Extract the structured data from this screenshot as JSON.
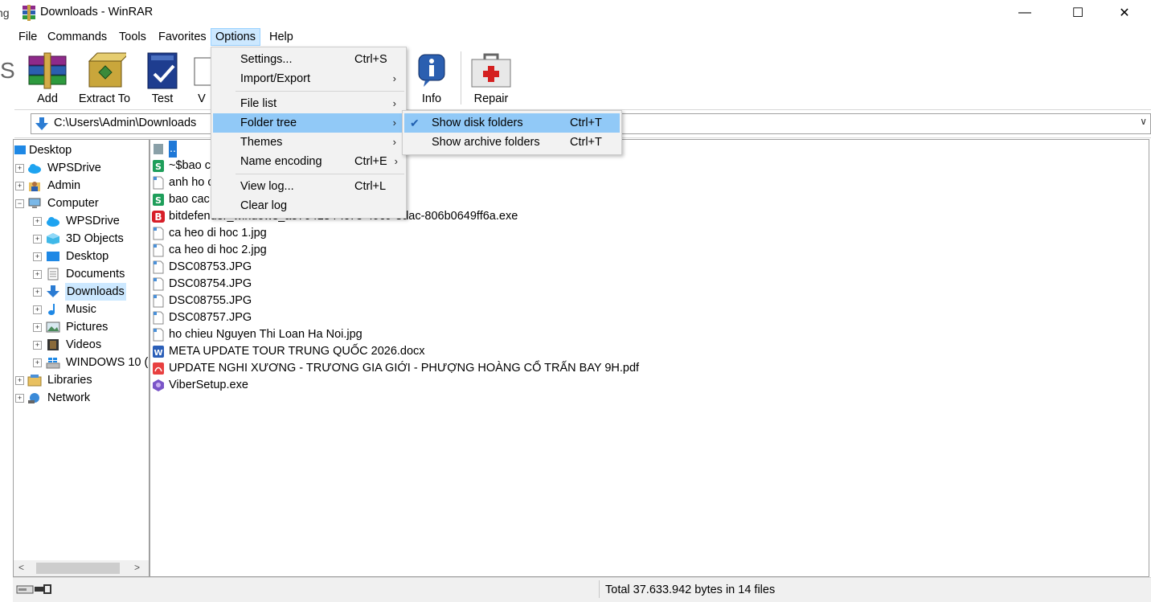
{
  "window": {
    "title": "Downloads - WinRAR",
    "minimize": "—",
    "maximize": "☐",
    "close": "✕"
  },
  "outside": {
    "partial_text": "ng",
    "partial_letter": "S"
  },
  "menubar": [
    "File",
    "Commands",
    "Tools",
    "Favorites",
    "Options",
    "Help"
  ],
  "toolbar": {
    "add": "Add",
    "extract_to": "Extract To",
    "test": "Test",
    "view": "V",
    "info": "Info",
    "repair": "Repair"
  },
  "address": {
    "path": "C:\\Users\\Admin\\Downloads",
    "dropdown": "∨"
  },
  "tree": [
    {
      "label": "Desktop"
    },
    {
      "label": "WPSDrive"
    },
    {
      "label": "Admin"
    },
    {
      "label": "Computer"
    },
    {
      "label": "WPSDrive"
    },
    {
      "label": "3D Objects"
    },
    {
      "label": "Desktop"
    },
    {
      "label": "Documents"
    },
    {
      "label": "Downloads"
    },
    {
      "label": "Music"
    },
    {
      "label": "Pictures"
    },
    {
      "label": "Videos"
    },
    {
      "label": "WINDOWS 10 ("
    },
    {
      "label": "Libraries"
    },
    {
      "label": "Network"
    }
  ],
  "tree_expanders": {
    "plus": "+",
    "minus": "−"
  },
  "tree_scroll": {
    "left": "<",
    "right": ">"
  },
  "files": [
    {
      "name": ".."
    },
    {
      "name": "~$bao c"
    },
    {
      "name": "anh ho c"
    },
    {
      "name": "bao cac"
    },
    {
      "name": "bitdefender_windows_a5704184-fc73-49c9-8dac-806b0649ff6a.exe"
    },
    {
      "name": "ca heo di hoc 1.jpg"
    },
    {
      "name": "ca heo di hoc 2.jpg"
    },
    {
      "name": "DSC08753.JPG"
    },
    {
      "name": "DSC08754.JPG"
    },
    {
      "name": "DSC08755.JPG"
    },
    {
      "name": "DSC08757.JPG"
    },
    {
      "name": "ho chieu Nguyen Thi Loan Ha Noi.jpg"
    },
    {
      "name": "META UPDATE TOUR TRUNG QUỐC 2026.docx"
    },
    {
      "name": "UPDATE NGHI XƯƠNG - TRƯƠNG GIA GIỚI - PHƯỢNG HOÀNG CỔ TRẤN BAY 9H.pdf"
    },
    {
      "name": "ViberSetup.exe"
    }
  ],
  "file_icon_letters": {
    "sheet": "S",
    "bitdefender": "B",
    "word": "W"
  },
  "options_menu": {
    "items": [
      {
        "label": "Settings...",
        "shortcut": "Ctrl+S"
      },
      {
        "label": "Import/Export",
        "arrow": "›"
      },
      {
        "label": "File list",
        "arrow": "›"
      },
      {
        "label": "Folder tree",
        "arrow": "›"
      },
      {
        "label": "Themes",
        "arrow": "›"
      },
      {
        "label": "Name encoding",
        "shortcut": "Ctrl+E",
        "arrow": "›"
      },
      {
        "label": "View log...",
        "shortcut": "Ctrl+L"
      },
      {
        "label": "Clear log"
      }
    ]
  },
  "folder_tree_submenu": {
    "items": [
      {
        "label": "Show disk folders",
        "shortcut": "Ctrl+T",
        "check": "✔"
      },
      {
        "label": "Show archive folders",
        "shortcut": "Ctrl+T"
      }
    ]
  },
  "status": {
    "text": "Total 37.633.942 bytes in 14 files"
  },
  "colors": {
    "highlight": "#91c9f7",
    "menu_active": "#cce8ff",
    "folder_blue": "#2b7cd3"
  }
}
